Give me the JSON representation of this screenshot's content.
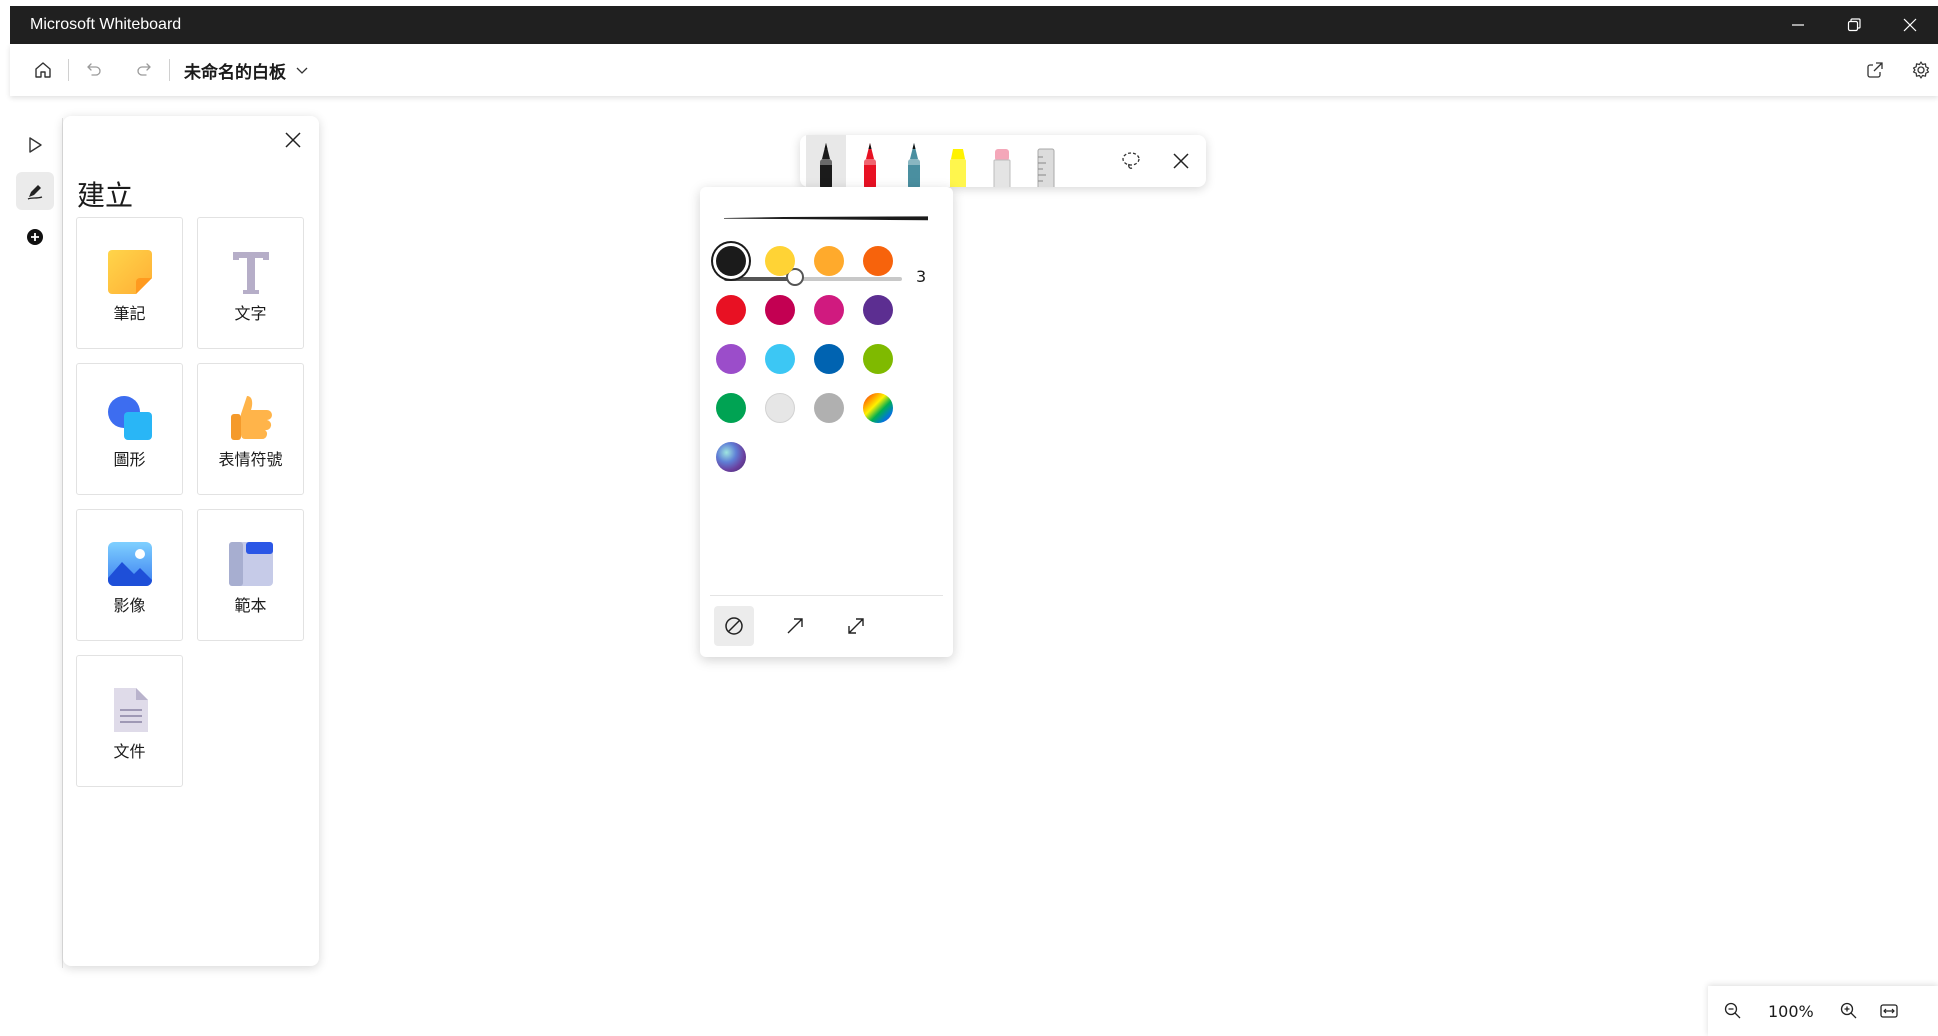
{
  "window": {
    "title": "Microsoft Whiteboard"
  },
  "toolbar": {
    "board_name": "未命名的白板"
  },
  "create_panel": {
    "title": "建立",
    "tiles": [
      {
        "label": "筆記",
        "icon": "sticky-note-icon"
      },
      {
        "label": "文字",
        "icon": "text-icon"
      },
      {
        "label": "圖形",
        "icon": "shapes-icon"
      },
      {
        "label": "表情符號",
        "icon": "thumbs-up-icon"
      },
      {
        "label": "影像",
        "icon": "image-icon"
      },
      {
        "label": "範本",
        "icon": "template-icon"
      },
      {
        "label": "文件",
        "icon": "document-icon"
      }
    ]
  },
  "pen_toolbar": {
    "pens": [
      {
        "name": "black-pen",
        "color": "#1b1b1b"
      },
      {
        "name": "red-pen",
        "color": "#e81123"
      },
      {
        "name": "galaxy-pen",
        "color": "#4a8fa0"
      },
      {
        "name": "highlighter",
        "color": "#fff200"
      },
      {
        "name": "eraser",
        "color": "#f4a7b9"
      },
      {
        "name": "ruler",
        "color": "#c8c8c8"
      }
    ],
    "active_pen": 0
  },
  "pen_settings": {
    "size_value": "3",
    "size_fraction": 0.4,
    "selected_color": 0,
    "colors": [
      "#1b1b1b",
      "#ffd335",
      "#ffaa2c",
      "#f7630c",
      "#e81123",
      "#c30052",
      "#d01a7f",
      "#5c2e91",
      "#9b4dca",
      "#3cc7f4",
      "#0063b1",
      "#7fba00",
      "#00a353",
      "#e6e6e6",
      "#b0b0b0",
      "rainbow",
      "galaxy"
    ]
  },
  "zoom": {
    "level": "100%"
  }
}
